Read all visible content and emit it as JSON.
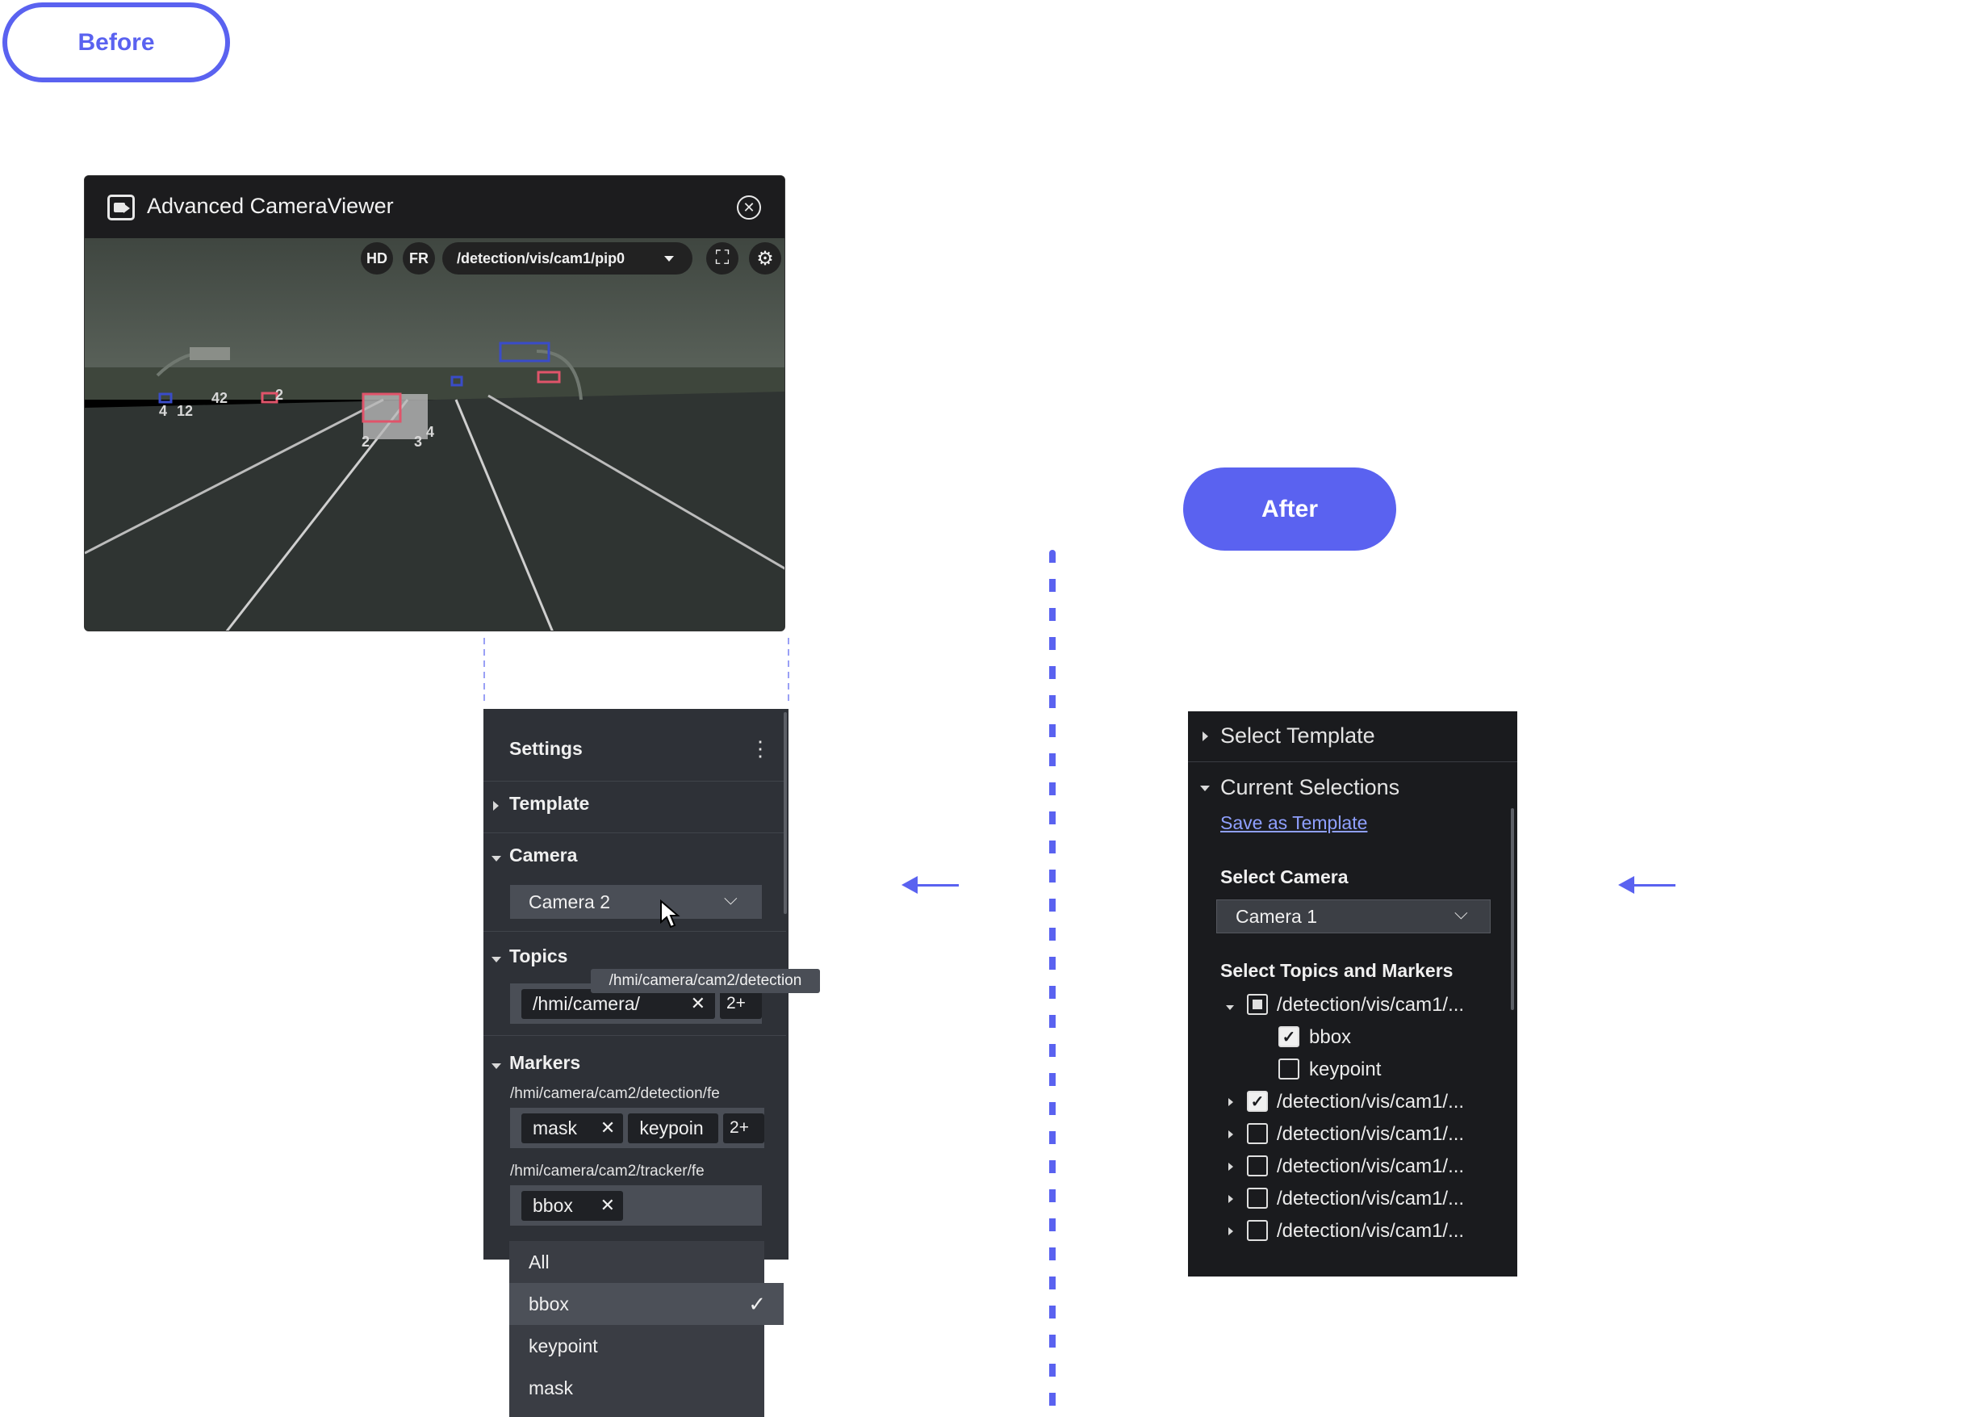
{
  "labels": {
    "before": "Before",
    "after": "After"
  },
  "viewer": {
    "title": "Advanced CameraViewer",
    "chips": {
      "hd": "HD",
      "fr": "FR",
      "topic": "/detection/vis/cam1/pip0"
    },
    "overlay_numbers": [
      "4",
      "12",
      "42",
      "2",
      "2",
      "3",
      "4"
    ]
  },
  "settings": {
    "title": "Settings",
    "menu_icon": "more-vertical-icon",
    "template_label": "Template",
    "camera_label": "Camera",
    "camera_value": "Camera 2",
    "topics_label": "Topics",
    "topic_tag": "/hmi/camera/",
    "topic_more": "2+",
    "tooltip": "/hmi/camera/cam2/detection",
    "markers_label": "Markers",
    "marker_group1_path": "/hmi/camera/cam2/detection/fe",
    "marker_group1_tags": [
      "mask",
      "keypoin"
    ],
    "marker_group1_more": "2+",
    "marker_group2_path": "/hmi/camera/cam2/tracker/fe",
    "marker_group2_tags": [
      "bbox"
    ],
    "dropdown_options": [
      "All",
      "bbox",
      "keypoint",
      "mask"
    ],
    "dropdown_selected": "bbox"
  },
  "after_panel": {
    "select_template": "Select Template",
    "current_selections": "Current Selections",
    "save_as_template": "Save as Template",
    "select_camera_label": "Select Camera",
    "camera_value": "Camera 1",
    "select_topics_label": "Select Topics and Markers",
    "tree": [
      {
        "label": "/detection/vis/cam1/...",
        "state": "partial",
        "expanded": true
      },
      {
        "label": "bbox",
        "state": "checked",
        "child": true
      },
      {
        "label": "keypoint",
        "state": "unchecked",
        "child": true
      },
      {
        "label": "/detection/vis/cam1/...",
        "state": "checked",
        "expanded": false
      },
      {
        "label": "/detection/vis/cam1/...",
        "state": "unchecked",
        "expanded": false
      },
      {
        "label": "/detection/vis/cam1/...",
        "state": "unchecked",
        "expanded": false
      },
      {
        "label": "/detection/vis/cam1/...",
        "state": "unchecked",
        "expanded": false
      },
      {
        "label": "/detection/vis/cam1/...",
        "state": "unchecked",
        "expanded": false
      }
    ]
  },
  "colors": {
    "accent": "#5a62f0",
    "panel": "#2e3137",
    "after_panel": "#1a1b1e"
  }
}
